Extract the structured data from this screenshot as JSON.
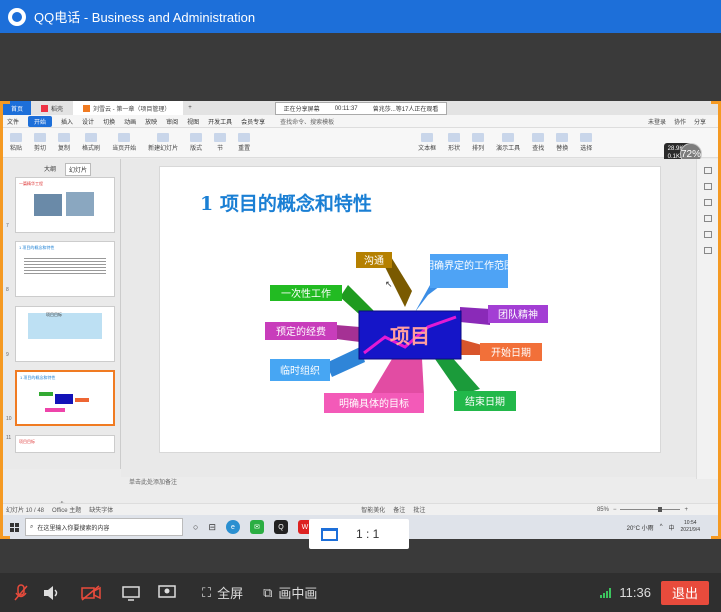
{
  "window": {
    "title": "QQ电话 - Business and Administration"
  },
  "wps": {
    "tabs": [
      {
        "label": "首页"
      },
      {
        "label": "稻壳"
      },
      {
        "label": "刘雪云 - 第一章（项目管理）"
      },
      {
        "label": "+"
      }
    ],
    "meeting_bar": {
      "sharing": "正在分享屏幕",
      "timer": "00:11:37",
      "viewers": "曾兆莎...等17人正在观看"
    },
    "menu": [
      "文件",
      "开始",
      "插入",
      "设计",
      "切换",
      "动画",
      "放映",
      "审阅",
      "视图",
      "开发工具",
      "会员专享"
    ],
    "menu_search": "查找命令、搜索模板",
    "menu_right": [
      "未登录",
      "协作",
      "分享"
    ],
    "ribbon": [
      "粘贴",
      "剪切",
      "复制",
      "格式刷",
      "当页开始",
      "新建幻灯片",
      "版式",
      "节",
      "重置",
      "文本框",
      "形状",
      "排列",
      "演示工具",
      "查找",
      "替换",
      "选择"
    ],
    "net_speed_up": "28.9K/s",
    "net_speed_down": "0.1K/s",
    "cpu_badge": "72%",
    "pane_tabs": [
      "大纲",
      "幻灯片"
    ],
    "thumbs": [
      {
        "num": "7",
        "title": "一篇精华工程"
      },
      {
        "num": "8",
        "title": "1 项目的概念和特性"
      },
      {
        "num": "9",
        "title": "项目目标"
      },
      {
        "num": "10",
        "title": "1 项目的概念和特性"
      },
      {
        "num": "11",
        "title": "项目目标"
      }
    ],
    "add_slide": "+",
    "notes_placeholder": "单击此处添加备注",
    "status": {
      "slide_count": "幻灯片 10 / 48",
      "theme": "Office 主题",
      "font_missing": "缺失字体",
      "smart_beautify": "智能美化",
      "notes": "备注",
      "comments": "批注",
      "zoom": "85%"
    }
  },
  "slide": {
    "title": "1  项目的概念和特性",
    "center": "项目",
    "arrows": [
      "沟通",
      "明确界定的工作范围",
      "一次性工作",
      "团队精神",
      "预定的经费",
      "开始日期",
      "临时组织",
      "结束日期",
      "明确具体的目标"
    ]
  },
  "taskbar": {
    "search_placeholder": "在这里输入你要搜索的内容",
    "weather": "20°C 小雨",
    "input_method": "中",
    "clock_time": "10:54",
    "clock_date": "2021/9/4"
  },
  "ratio_label": "1 : 1",
  "bottom": {
    "fullscreen": "全屏",
    "pip": "画中画",
    "time": "11:36",
    "quit": "退出"
  },
  "colors": {
    "accent": "#1d6fd9",
    "quit": "#e84b3c",
    "share_border": "#f59a23"
  }
}
